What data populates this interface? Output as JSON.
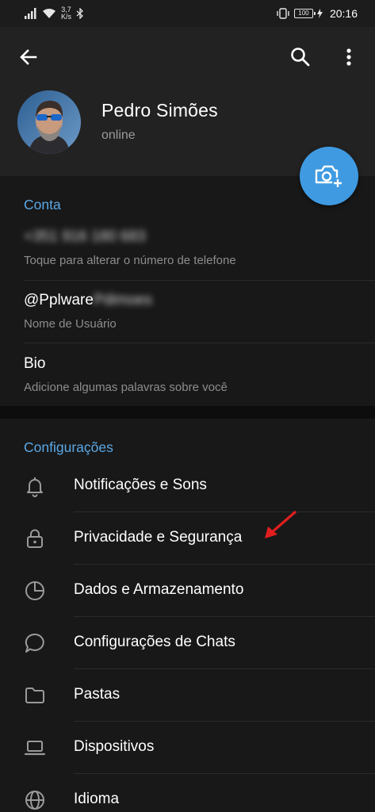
{
  "status_bar": {
    "speed_value": "3,7",
    "speed_unit": "K/s",
    "battery": "100",
    "time": "20:16"
  },
  "toolbar": {
    "back_icon": "arrow-left-icon",
    "search_icon": "search-icon",
    "more_icon": "more-vertical-icon"
  },
  "profile": {
    "name": "Pedro Simões",
    "status": "online",
    "set_photo_icon": "camera-add-icon"
  },
  "account": {
    "title": "Conta",
    "phone": "+351 916 180 683",
    "phone_hint": "Toque para alterar o número de telefone",
    "username_visible": "@Pplware",
    "username_blurred": "Pdimoes",
    "username_hint": "Nome de Usuário",
    "bio_label": "Bio",
    "bio_hint": "Adicione algumas palavras sobre você"
  },
  "settings": {
    "title": "Configurações",
    "items": [
      {
        "label": "Notificações e Sons",
        "icon": "bell-icon"
      },
      {
        "label": "Privacidade e Segurança",
        "icon": "lock-icon"
      },
      {
        "label": "Dados e Armazenamento",
        "icon": "pie-chart-icon"
      },
      {
        "label": "Configurações de Chats",
        "icon": "chat-bubble-icon"
      },
      {
        "label": "Pastas",
        "icon": "folder-icon"
      },
      {
        "label": "Dispositivos",
        "icon": "laptop-icon"
      },
      {
        "label": "Idioma",
        "icon": "globe-icon"
      }
    ]
  },
  "colors": {
    "accent": "#5aa8e6",
    "fab": "#3f9ae1",
    "annotation_arrow": "#e01e1e",
    "background": "#181818",
    "header": "#222222"
  }
}
